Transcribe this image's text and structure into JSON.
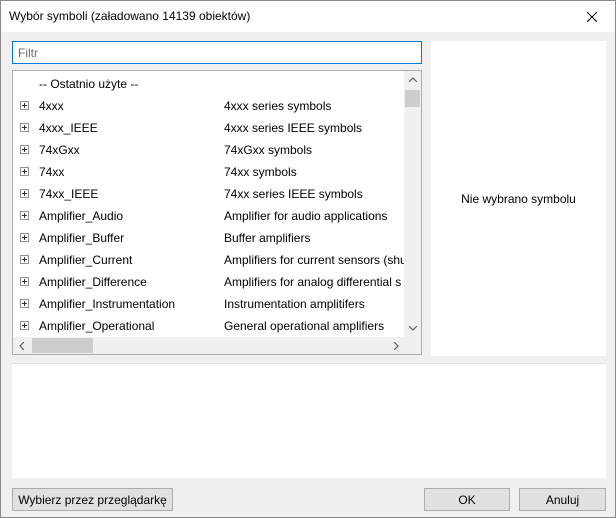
{
  "window": {
    "title": "Wybór symboli (załadowano 14139 obiektów)"
  },
  "filter": {
    "placeholder": "Filtr",
    "value": ""
  },
  "tree": {
    "recent_header": "-- Ostatnio użyte --",
    "rows": [
      {
        "name": "4xxx",
        "description": "4xxx series symbols"
      },
      {
        "name": "4xxx_IEEE",
        "description": "4xxx series IEEE symbols"
      },
      {
        "name": "74xGxx",
        "description": "74xGxx symbols"
      },
      {
        "name": "74xx",
        "description": "74xx symbols"
      },
      {
        "name": "74xx_IEEE",
        "description": "74xx series IEEE symbols"
      },
      {
        "name": "Amplifier_Audio",
        "description": "Amplifier for audio applications"
      },
      {
        "name": "Amplifier_Buffer",
        "description": "Buffer amplifiers"
      },
      {
        "name": "Amplifier_Current",
        "description": "Amplifiers for current sensors (shu"
      },
      {
        "name": "Amplifier_Difference",
        "description": "Amplifiers for analog differential s"
      },
      {
        "name": "Amplifier_Instrumentation",
        "description": "Instrumentation amplitifers"
      },
      {
        "name": "Amplifier_Operational",
        "description": "General operational amplifiers"
      }
    ]
  },
  "preview": {
    "empty_text": "Nie wybrano symbolu"
  },
  "buttons": {
    "browser": "Wybierz przez przeglądarkę",
    "ok": "OK",
    "cancel": "Anuluj"
  },
  "icons": {
    "close": "close-icon",
    "expand": "expand-plus-icon",
    "scroll_up": "scroll-up-icon",
    "scroll_down": "scroll-down-icon",
    "scroll_left": "scroll-left-icon",
    "scroll_right": "scroll-right-icon"
  },
  "colors": {
    "focus_border": "#0078d7",
    "window_bg": "#f0f0f0"
  }
}
